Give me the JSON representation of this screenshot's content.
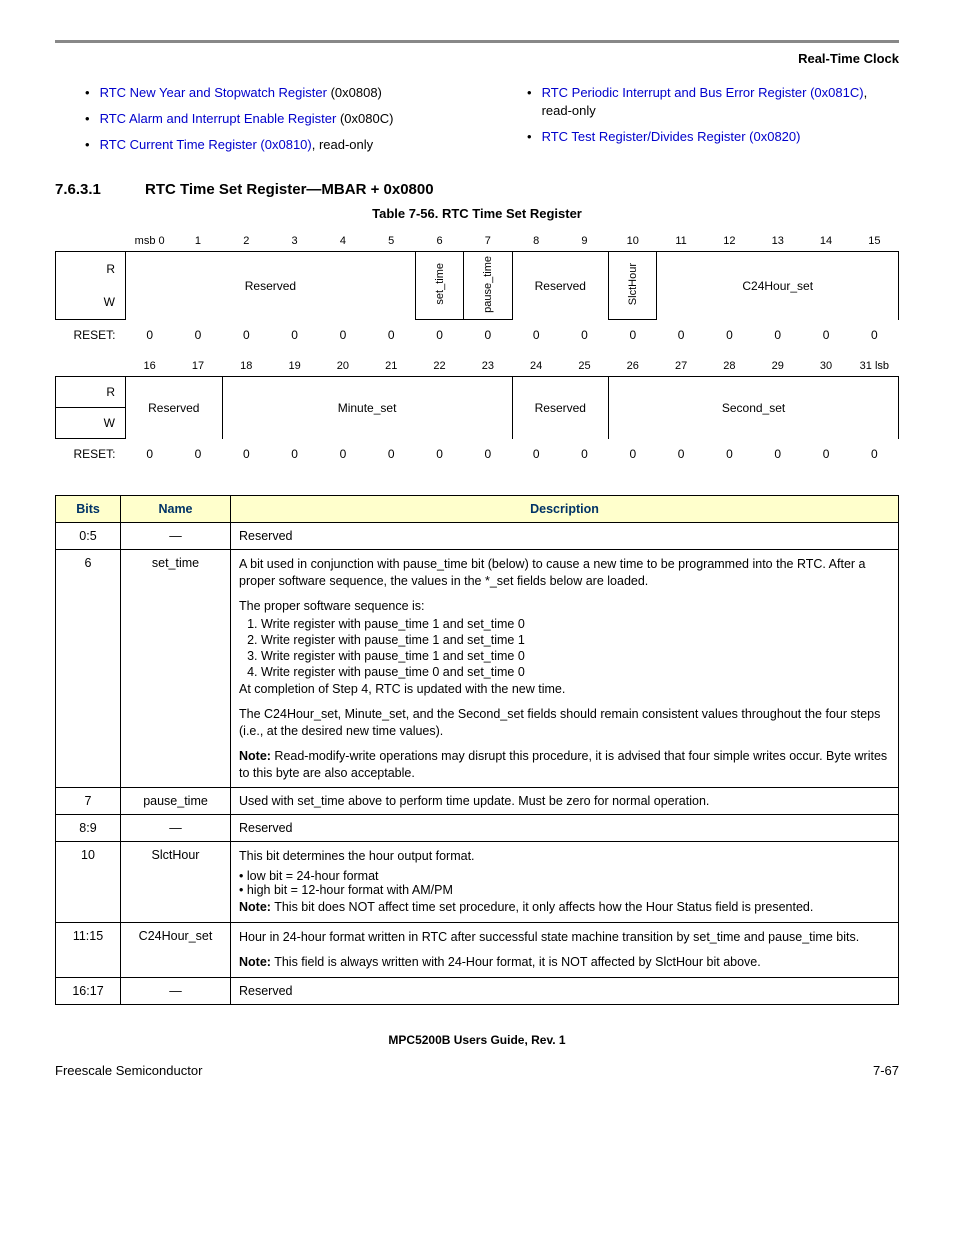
{
  "headerLabel": "Real-Time Clock",
  "links": {
    "left": [
      {
        "anchor": "RTC New Year and Stopwatch Register",
        "suffix": " (0x0808)"
      },
      {
        "anchor": "RTC Alarm and Interrupt Enable Register",
        "suffix": " (0x080C)"
      },
      {
        "anchor": "RTC Current Time Register",
        "addr": " (0x0810)",
        "suffix": ", read-only"
      }
    ],
    "right": [
      {
        "anchor": "RTC Periodic Interrupt and Bus Error Register",
        "addr": " (0x081C)",
        "suffix": ", read-only"
      },
      {
        "anchor": "RTC Test Register/Divides Register",
        "addr": " (0x0820)",
        "suffix": ""
      }
    ]
  },
  "section": {
    "num": "7.6.3.1",
    "title": "RTC Time Set Register—MBAR + 0x0800"
  },
  "tableCaption": "Table 7-56. RTC Time Set Register",
  "reg": {
    "bitsTop": [
      "msb 0",
      "1",
      "2",
      "3",
      "4",
      "5",
      "6",
      "7",
      "8",
      "9",
      "10",
      "11",
      "12",
      "13",
      "14",
      "15"
    ],
    "row1": {
      "reserved1": "Reserved",
      "set_time": "set_time",
      "pause_time": "pause_time",
      "reserved2": "Reserved",
      "slcthour": "SlctHour",
      "c24": "C24Hour_set"
    },
    "resetLabel": "RESET:",
    "reset1": [
      "0",
      "0",
      "0",
      "0",
      "0",
      "0",
      "0",
      "0",
      "0",
      "0",
      "0",
      "0",
      "0",
      "0",
      "0",
      "0"
    ],
    "bitsBot": [
      "16",
      "17",
      "18",
      "19",
      "20",
      "21",
      "22",
      "23",
      "24",
      "25",
      "26",
      "27",
      "28",
      "29",
      "30",
      "31 lsb"
    ],
    "row2": {
      "reserved3": "Reserved",
      "minute": "Minute_set",
      "reserved4": "Reserved",
      "second": "Second_set"
    },
    "reset2": [
      "0",
      "0",
      "0",
      "0",
      "0",
      "0",
      "0",
      "0",
      "0",
      "0",
      "0",
      "0",
      "0",
      "0",
      "0",
      "0"
    ],
    "R": "R",
    "W": "W"
  },
  "descHeaders": {
    "bits": "Bits",
    "name": "Name",
    "desc": "Description"
  },
  "rows": [
    {
      "bits": "0:5",
      "name": "—",
      "desc_simple": "Reserved"
    },
    {
      "bits": "6",
      "name": "set_time",
      "p1": "A bit used in conjunction with pause_time bit (below) to cause a new time to be programmed into the RTC. After a proper software sequence, the values in the *_set fields below are loaded.",
      "p2": "The proper software sequence is:",
      "steps": [
        "Write register with pause_time 1 and set_time 0",
        "Write register with pause_time 1 and set_time 1",
        "Write register with pause_time 1 and set_time 0",
        "Write register with pause_time 0 and set_time 0"
      ],
      "p3": "At completion of Step 4, RTC is updated with the new time.",
      "p4": "The C24Hour_set, Minute_set, and the Second_set fields should remain consistent values throughout the four steps (i.e., at the desired new time values).",
      "noteLabel": "Note:",
      "note": "  Read-modify-write operations may disrupt this procedure, it is advised that four simple writes occur. Byte writes to this byte are also acceptable."
    },
    {
      "bits": "7",
      "name": "pause_time",
      "desc_simple": "Used with set_time above to perform time update. Must be zero for normal operation."
    },
    {
      "bits": "8:9",
      "name": "—",
      "desc_simple": "Reserved"
    },
    {
      "bits": "10",
      "name": "SlctHour",
      "p1": "This bit determines the hour output format.",
      "b1": "low bit = 24-hour format",
      "b2": "high bit = 12-hour format with AM/PM",
      "noteLabel": "Note:",
      "note": "  This bit does NOT affect time set procedure, it only affects how the Hour Status field is presented."
    },
    {
      "bits": "11:15",
      "name": "C24Hour_set",
      "p1": "Hour in 24-hour format written in RTC after successful state machine transition by set_time and pause_time bits.",
      "noteLabel": "Note:",
      "note": "  This field is always written with 24-Hour format, it is NOT affected by SlctHour bit above."
    },
    {
      "bits": "16:17",
      "name": "—",
      "desc_simple": "Reserved"
    }
  ],
  "footer": {
    "center": "MPC5200B Users Guide, Rev. 1",
    "left": "Freescale Semiconductor",
    "right": "7-67"
  }
}
